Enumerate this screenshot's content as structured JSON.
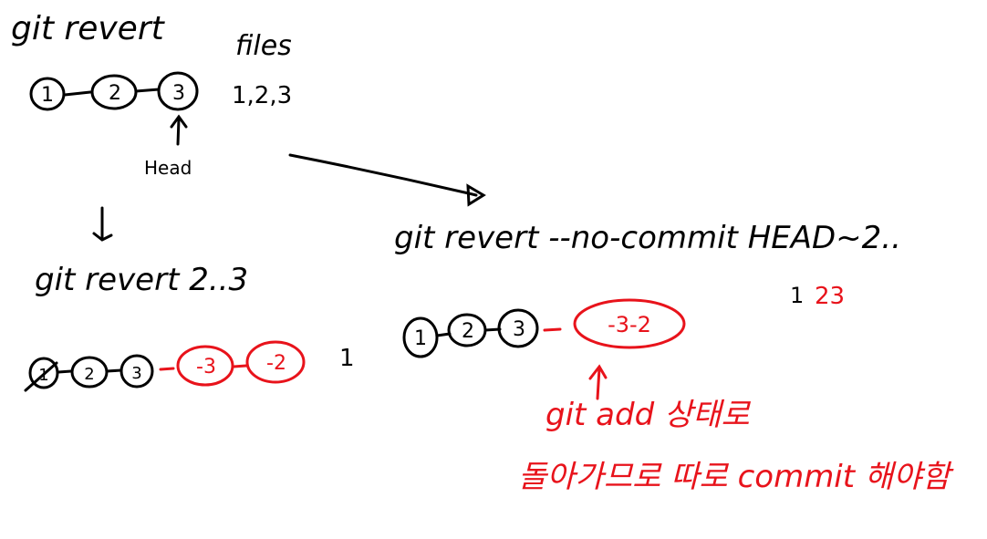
{
  "colors": {
    "ink": "#000000",
    "accent": "#e8131b",
    "background": "#ffffff"
  },
  "top": {
    "title": "git revert",
    "files_label": "files",
    "files_value": "1,2,3",
    "commits": [
      "1",
      "2",
      "3"
    ],
    "head_label": "Head"
  },
  "left": {
    "title": "git revert 2..3",
    "commits": [
      "1",
      "2",
      "3"
    ],
    "revert_commits": [
      "-3",
      "-2"
    ],
    "files_value": "1"
  },
  "right": {
    "title": "git revert --no-commit HEAD~2..",
    "commits": [
      "1",
      "2",
      "3"
    ],
    "revert_group": "-3-2",
    "files_prefix": "1",
    "files_value": "23",
    "note_line1": "git add 상태로",
    "note_line2": "돌아가므로 따로 commit 해야함"
  }
}
